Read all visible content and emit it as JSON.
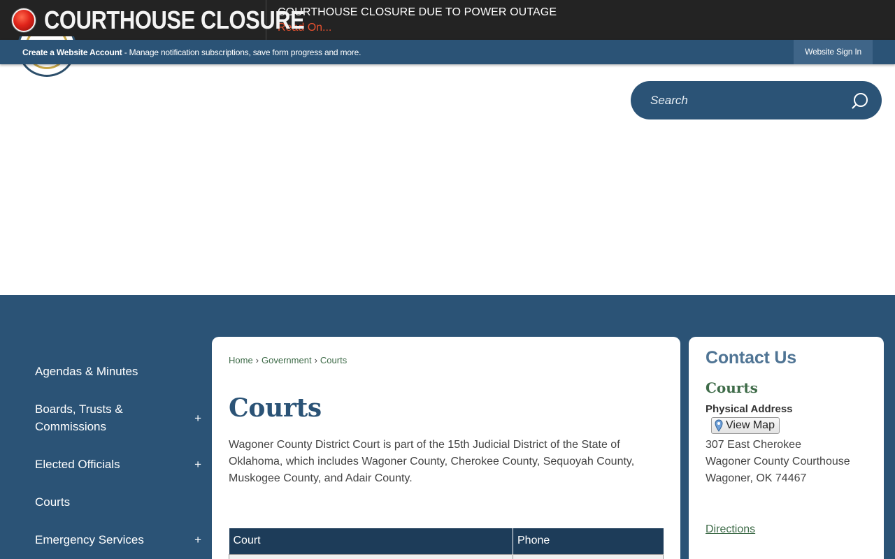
{
  "alert": {
    "title": "COURTHOUSE CLOSURE",
    "headline": "COURTHOUSE CLOSURE DUE TO POWER OUTAGE",
    "read_on": "Read On..."
  },
  "account_bar": {
    "create_account": "Create a Website Account",
    "description": " - Manage notification subscriptions, save form progress and more.",
    "sign_in": "Website Sign In"
  },
  "search": {
    "placeholder": "Search"
  },
  "sidebar": {
    "items": [
      {
        "label": "Agendas & Minutes",
        "expandable": false
      },
      {
        "label": "Boards, Trusts & Commissions",
        "expandable": true
      },
      {
        "label": "Elected Officials",
        "expandable": true
      },
      {
        "label": "Courts",
        "expandable": false
      },
      {
        "label": "Emergency Services",
        "expandable": true
      }
    ],
    "expand_symbol": "+"
  },
  "breadcrumb": {
    "items": [
      "Home",
      "Government",
      "Courts"
    ],
    "separator": "›"
  },
  "main": {
    "title": "Courts",
    "intro": "Wagoner County District Court is part of the 15th Judicial District of the State of Oklahoma, which includes Wagoner County, Cherokee County, Sequoyah County, Muskogee County, and Adair County.",
    "table": {
      "headers": [
        "Court",
        "Phone"
      ]
    }
  },
  "contact": {
    "heading": "Contact Us",
    "name": "Courts",
    "physical_address_label": "Physical Address",
    "view_map": "View Map",
    "address_line1": "307 East Cherokee",
    "address_line2": "Wagoner County Courthouse",
    "address_line3": "Wagoner, OK 74467",
    "directions": "Directions"
  },
  "colors": {
    "brand_blue": "#2b5376",
    "dark_blue": "#1d3c59",
    "accent_green": "#3e6b48",
    "alert_red": "#e8512f",
    "alert_bg": "#232323"
  }
}
